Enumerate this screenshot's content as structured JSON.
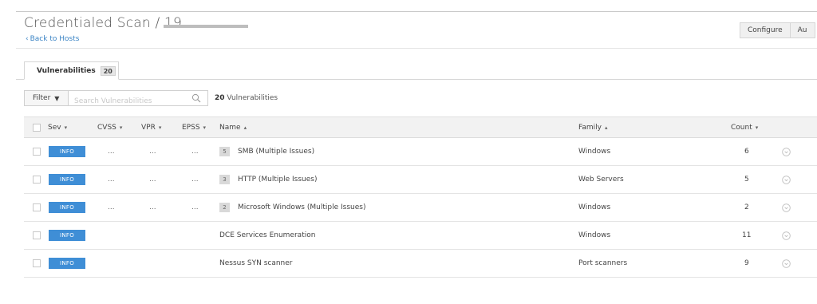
{
  "header": {
    "title": "Credentialed Scan / 19.",
    "back_link": "Back to Hosts"
  },
  "toolbar": {
    "configure_label": "Configure",
    "audit_label": "Au"
  },
  "tabs": [
    {
      "label": "Vulnerabilities",
      "count": "20"
    }
  ],
  "filter": {
    "label": "Filter",
    "search_placeholder": "Search Vulnerabilities",
    "result_count": "20",
    "result_label": "Vulnerabilities"
  },
  "table": {
    "columns": {
      "sev": "Sev",
      "cvss": "CVSS",
      "vpr": "VPR",
      "epss": "EPSS",
      "name": "Name",
      "family": "Family",
      "count": "Count"
    },
    "rows": [
      {
        "sev": "INFO",
        "cvss": "...",
        "vpr": "...",
        "epss": "...",
        "group_count": "5",
        "name": "SMB (Multiple Issues)",
        "family": "Windows",
        "count": "6"
      },
      {
        "sev": "INFO",
        "cvss": "...",
        "vpr": "...",
        "epss": "...",
        "group_count": "3",
        "name": "HTTP (Multiple Issues)",
        "family": "Web Servers",
        "count": "5"
      },
      {
        "sev": "INFO",
        "cvss": "...",
        "vpr": "...",
        "epss": "...",
        "group_count": "2",
        "name": "Microsoft Windows (Multiple Issues)",
        "family": "Windows",
        "count": "2"
      },
      {
        "sev": "INFO",
        "name": "DCE Services Enumeration",
        "family": "Windows",
        "count": "11"
      },
      {
        "sev": "INFO",
        "name": "Nessus SYN scanner",
        "family": "Port scanners",
        "count": "9"
      }
    ]
  },
  "colors": {
    "sev_info": "#3f8ed6",
    "link": "#3b84c5"
  }
}
